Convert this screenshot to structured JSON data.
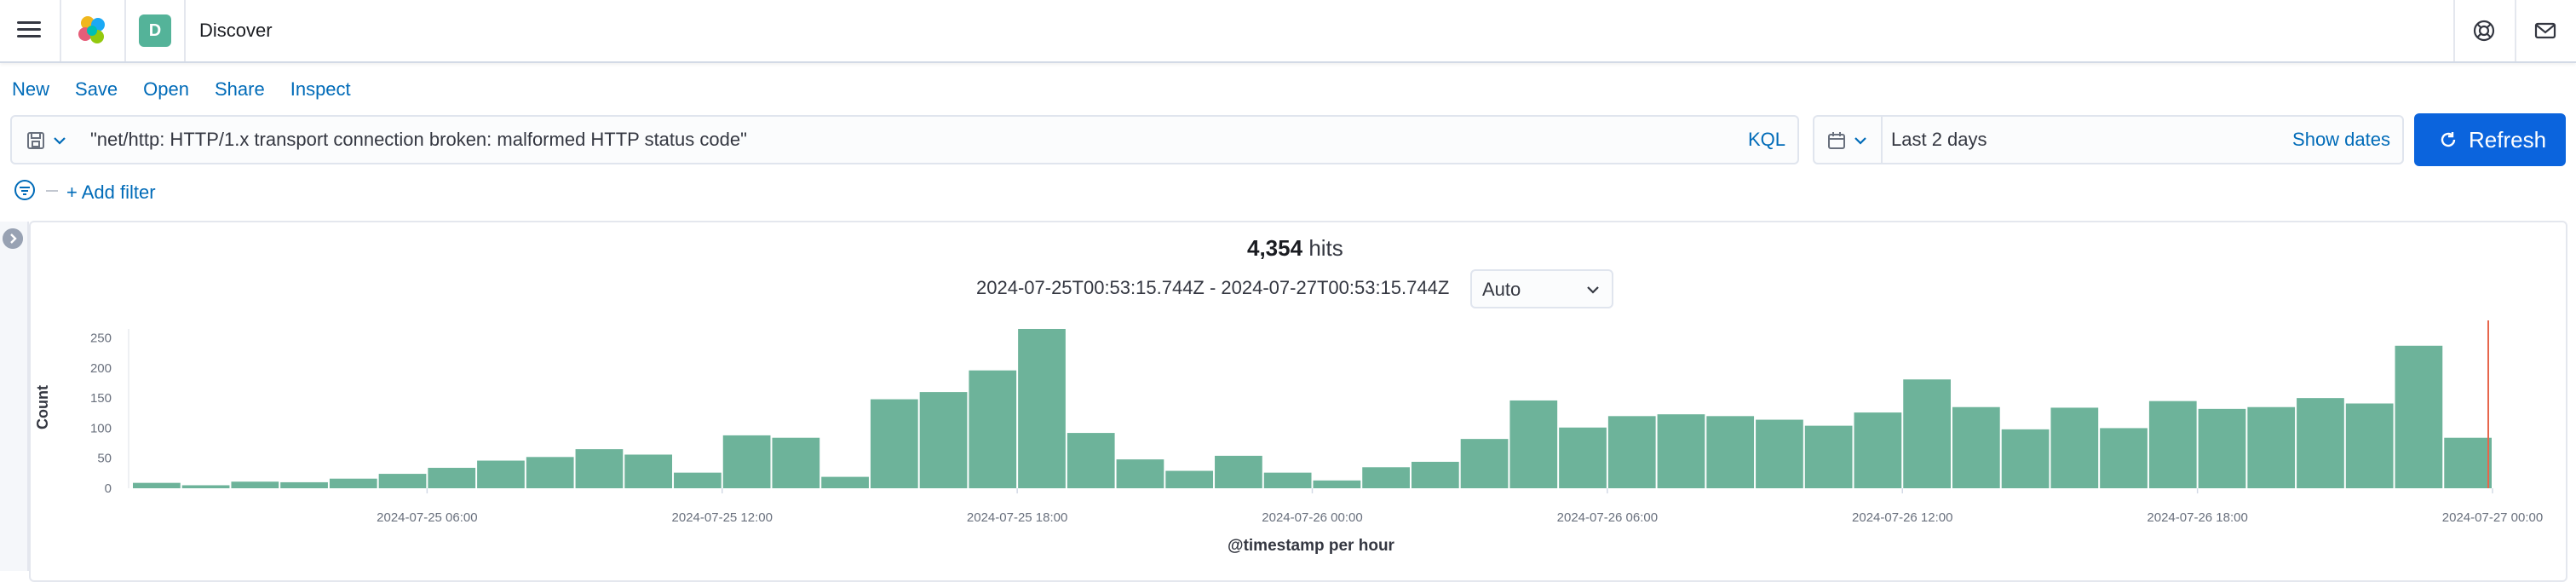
{
  "header": {
    "space_initial": "D",
    "app_title": "Discover"
  },
  "top_nav": [
    {
      "label": "New"
    },
    {
      "label": "Save"
    },
    {
      "label": "Open"
    },
    {
      "label": "Share"
    },
    {
      "label": "Inspect"
    }
  ],
  "query": {
    "text": "\"net/http: HTTP/1.x transport connection broken: malformed HTTP status code\"",
    "language_label": "KQL"
  },
  "date_picker": {
    "label": "Last 2 days",
    "show_dates_label": "Show dates"
  },
  "refresh_label": "Refresh",
  "filter": {
    "add_label": "+ Add filter"
  },
  "results": {
    "hits_count": "4,354",
    "hits_word": "hits",
    "time_range": "2024-07-25T00:53:15.744Z - 2024-07-27T00:53:15.744Z",
    "interval_value": "Auto"
  },
  "colors": {
    "bar": "#6db39a",
    "accent": "#006bb8",
    "refresh_bg": "#0b64dd",
    "now_line": "#e7664c"
  },
  "chart_data": {
    "type": "bar",
    "ylabel": "Count",
    "xlabel": "@timestamp per hour",
    "ylim": [
      0,
      265
    ],
    "y_ticks": [
      0,
      50,
      100,
      150,
      200,
      250
    ],
    "x_tick_labels": [
      "2024-07-25 06:00",
      "2024-07-25 12:00",
      "2024-07-25 18:00",
      "2024-07-26 00:00",
      "2024-07-26 06:00",
      "2024-07-26 12:00",
      "2024-07-26 18:00",
      "2024-07-27 00:00"
    ],
    "x_tick_bar_index": [
      6,
      12,
      18,
      24,
      30,
      36,
      42,
      48
    ],
    "grid": false,
    "values": [
      9,
      5,
      11,
      10,
      16,
      24,
      34,
      46,
      52,
      65,
      56,
      26,
      88,
      84,
      19,
      148,
      160,
      196,
      265,
      92,
      48,
      29,
      54,
      26,
      13,
      35,
      44,
      82,
      146,
      101,
      120,
      123,
      120,
      114,
      104,
      126,
      181,
      135,
      98,
      134,
      100,
      145,
      132,
      135,
      150,
      141,
      237,
      84
    ]
  }
}
